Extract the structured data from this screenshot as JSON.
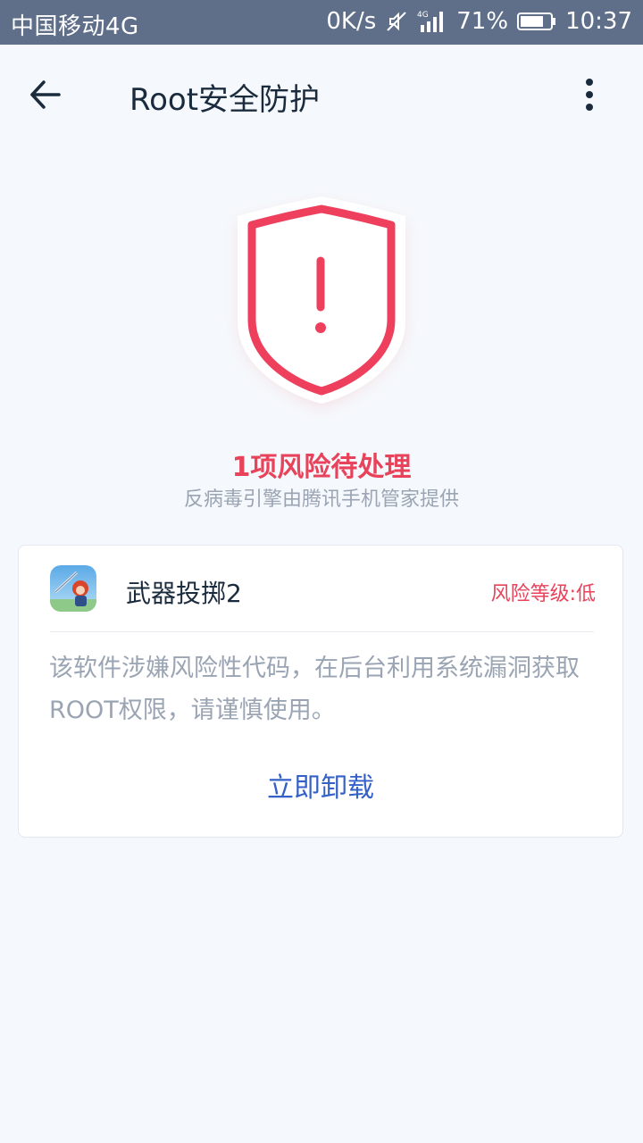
{
  "status_bar": {
    "carrier": "中国移动4G",
    "speed": "0K/s",
    "network": "4G",
    "battery": "71%",
    "time": "10:37"
  },
  "header": {
    "back_icon": "arrow-left-icon",
    "title": "Root安全防护",
    "more_icon": "more-vertical-icon"
  },
  "summary": {
    "shield_icon": "shield-alert-icon",
    "risk_count_text": "1项风险待处理",
    "provider_text": "反病毒引擎由腾讯手机管家提供"
  },
  "risk_card": {
    "app_icon": "app-icon",
    "app_name": "武器投掷2",
    "risk_level": "风险等级:低",
    "description": "该软件涉嫌风险性代码，在后台利用系统漏洞获取ROOT权限，请谨慎使用。",
    "action_label": "立即卸载"
  },
  "colors": {
    "status_bar_bg": "#5f6f8a",
    "background": "#f5f8fc",
    "danger": "#e8435b",
    "action": "#3461c8",
    "muted_text": "#9aa4b3",
    "primary_text": "#1b2b3e"
  }
}
